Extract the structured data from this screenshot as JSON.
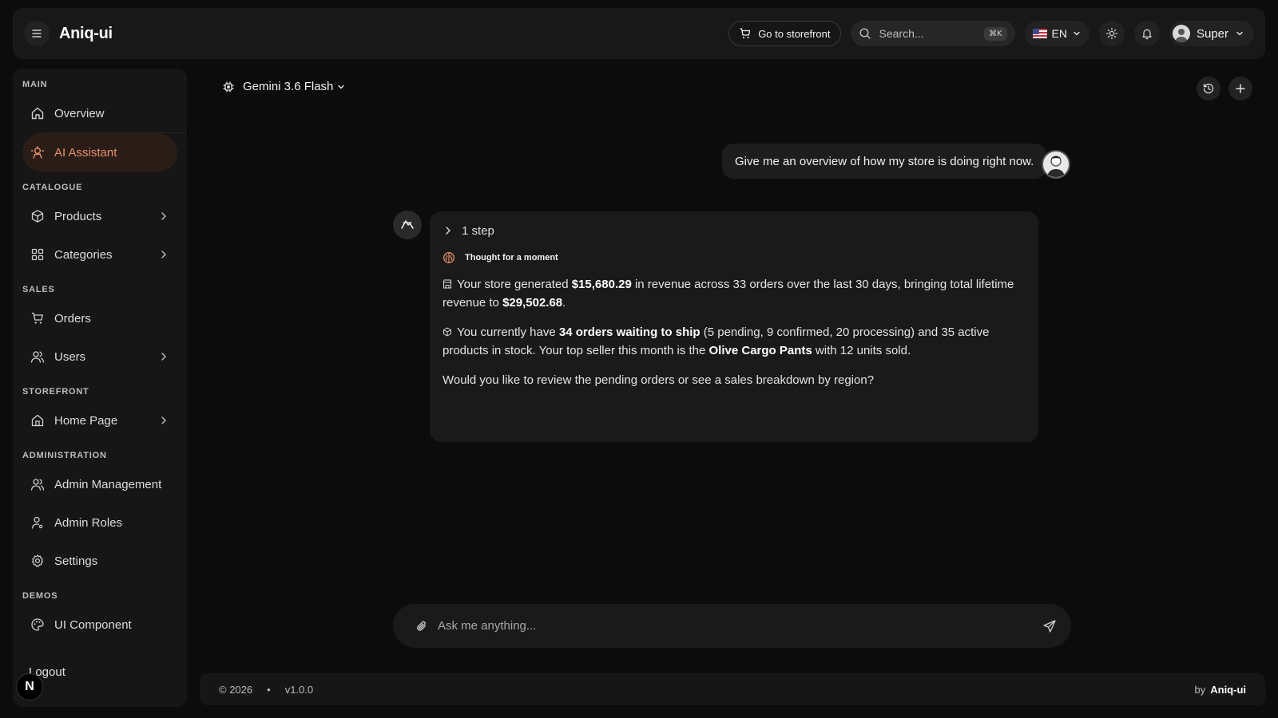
{
  "header": {
    "brand": "Aniq-ui",
    "storefront_label": "Go to storefront",
    "search_placeholder": "Search...",
    "search_shortcut": "⌘K",
    "language": "EN",
    "user_name": "Super"
  },
  "sidebar": {
    "sections": {
      "main": "MAIN",
      "catalogue": "CATALOGUE",
      "sales": "SALES",
      "storefront": "STOREFRONT",
      "administration": "ADMINISTRATION",
      "demos": "DEMOS"
    },
    "items": {
      "overview": "Overview",
      "ai_assistant": "AI Assistant",
      "products": "Products",
      "categories": "Categories",
      "orders": "Orders",
      "users": "Users",
      "home_page": "Home Page",
      "admin_management": "Admin Management",
      "admin_roles": "Admin Roles",
      "settings": "Settings",
      "ui_component": "UI Component"
    },
    "logout": "Logout",
    "badge": "N",
    "active_item": "AI Assistant",
    "accent_color": "#e8906a"
  },
  "chat": {
    "model": "Gemini 3.6 Flash",
    "user_message": "Give me an overview of how my store is doing right now.",
    "steps_label": "1 step",
    "thought_label": "Thought for a moment",
    "para1": {
      "t1": "Your store generated ",
      "revenue_30d": "$15,680.29",
      "t2": " in revenue across 33 orders over the last 30 days, bringing total lifetime revenue to ",
      "revenue_lifetime": "$29,502.68",
      "t3": "."
    },
    "para2": {
      "t1": "You currently have ",
      "orders_waiting": "34 orders waiting to ship",
      "t2": " (5 pending, 9 confirmed, 20 processing) and 35 active products in stock. Your top seller this month is the ",
      "top_seller": "Olive Cargo Pants",
      "t3": " with 12 units sold."
    },
    "para3": "Would you like to review the pending orders or see a sales breakdown by region?",
    "composer_placeholder": "Ask me anything..."
  },
  "footer": {
    "copyright": "© 2026",
    "separator": "•",
    "version": "v1.0.0",
    "by_label": "by",
    "by_name": "Aniq-ui"
  }
}
